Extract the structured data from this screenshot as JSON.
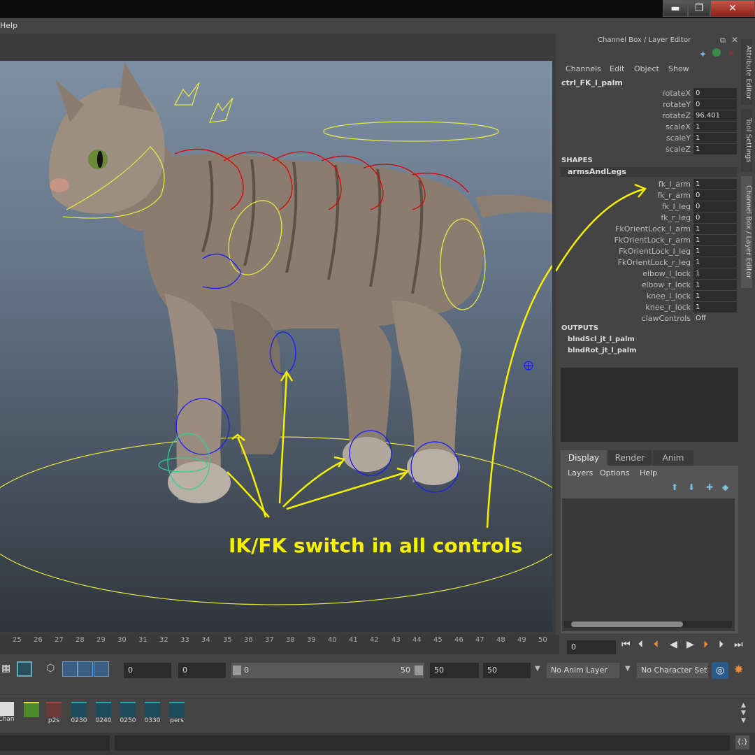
{
  "menubar": {
    "help": "Help"
  },
  "window_buttons": {
    "minimize": "▬",
    "maximize": "❐",
    "close": "✕"
  },
  "viewport": {
    "annotation": "IK/FK switch in all controls"
  },
  "channel_box": {
    "title": "Channel Box / Layer Editor",
    "menu": [
      "Channels",
      "Edit",
      "Object",
      "Show"
    ],
    "object_name": "ctrl_FK_l_palm",
    "attributes": [
      {
        "name": "rotateX",
        "value": "0"
      },
      {
        "name": "rotateY",
        "value": "0"
      },
      {
        "name": "rotateZ",
        "value": "96.401"
      },
      {
        "name": "scaleX",
        "value": "1"
      },
      {
        "name": "scaleY",
        "value": "1"
      },
      {
        "name": "scaleZ",
        "value": "1"
      }
    ],
    "shapes_header": "SHAPES",
    "shape_name": "armsAndLegs",
    "shape_attributes": [
      {
        "name": "fk_l_arm",
        "value": "1"
      },
      {
        "name": "fk_r_arm",
        "value": "0"
      },
      {
        "name": "fk_l_leg",
        "value": "0"
      },
      {
        "name": "fk_r_leg",
        "value": "0"
      },
      {
        "name": "FkOrientLock_l_arm",
        "value": "1"
      },
      {
        "name": "FkOrientLock_r_arm",
        "value": "1"
      },
      {
        "name": "FkOrientLock_l_leg",
        "value": "1"
      },
      {
        "name": "FkOrientLock_r_leg",
        "value": "1"
      },
      {
        "name": "elbow_l_lock",
        "value": "1"
      },
      {
        "name": "elbow_r_lock",
        "value": "1"
      },
      {
        "name": "knee_l_lock",
        "value": "1"
      },
      {
        "name": "knee_r_lock",
        "value": "1"
      },
      {
        "name": "clawControls",
        "value": "Off"
      }
    ],
    "outputs_header": "OUTPUTS",
    "outputs": [
      "blndScl_jt_l_palm",
      "blndRot_jt_l_palm"
    ]
  },
  "side_tabs": [
    "Attribute Editor",
    "Tool Settings",
    "Channel Box / Layer Editor"
  ],
  "layer_editor": {
    "tabs": [
      "Display",
      "Render",
      "Anim"
    ],
    "menu": [
      "Layers",
      "Options",
      "Help"
    ]
  },
  "timeline": {
    "ticks": [
      "25",
      "26",
      "27",
      "28",
      "29",
      "30",
      "31",
      "32",
      "33",
      "34",
      "35",
      "36",
      "37",
      "38",
      "39",
      "40",
      "41",
      "42",
      "43",
      "44",
      "45",
      "46",
      "47",
      "48",
      "49",
      "50"
    ],
    "current_frame": "0"
  },
  "range": {
    "start": "0",
    "anim_start": "0",
    "slider_start": "0",
    "slider_end": "50",
    "anim_end": "50",
    "end": "50",
    "anim_layer": "No Anim Layer",
    "char_set": "No Character Set"
  },
  "shelf": {
    "items": [
      "Chan",
      "",
      "p2s",
      "0230",
      "0240",
      "0250",
      "0330",
      "pers"
    ]
  },
  "colors": {
    "annotation": "#f5f000",
    "fk_ctrl": "#1a1aff",
    "ik_ctrl": "#e00000",
    "selection": "#e8e840"
  }
}
